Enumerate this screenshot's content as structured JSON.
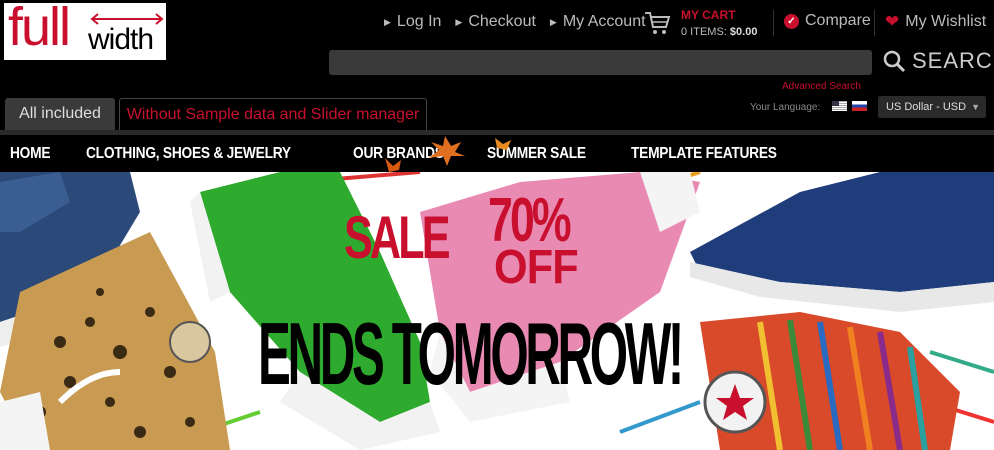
{
  "logo": {
    "part1": "full",
    "part2": "width"
  },
  "top_links": [
    {
      "label": "Log In"
    },
    {
      "label": "Checkout"
    },
    {
      "label": "My Account"
    }
  ],
  "cart": {
    "title": "MY CART",
    "items_label": "0 ITEMS:",
    "total": "$0.00"
  },
  "compare": {
    "label": "Compare"
  },
  "wishlist": {
    "label": "My Wishlist"
  },
  "search": {
    "value": "",
    "placeholder": "",
    "button_label": "SEARCH",
    "advanced_label": "Advanced Search"
  },
  "tabs": [
    {
      "label": "All included",
      "active": true
    },
    {
      "label": "Without Sample data and Slider manager",
      "active": false
    }
  ],
  "language": {
    "label": "Your Language:",
    "flags": [
      "us-flag-icon",
      "ru-flag-icon"
    ]
  },
  "currency": {
    "selected": "US Dollar - USD"
  },
  "nav": [
    {
      "label": "HOME"
    },
    {
      "label": "CLOTHING, SHOES & JEWELRY"
    },
    {
      "label": "OUR BRANDS"
    },
    {
      "label": "SUMMER SALE"
    },
    {
      "label": "TEMPLATE FEATURES"
    }
  ],
  "banner": {
    "sale": "SALE",
    "percent": "70%",
    "off": "OFF",
    "headline": "ENDS TOMORROW!"
  },
  "colors": {
    "accent": "#c8102e",
    "background": "#000000",
    "input_bg": "#3a3a3a"
  }
}
